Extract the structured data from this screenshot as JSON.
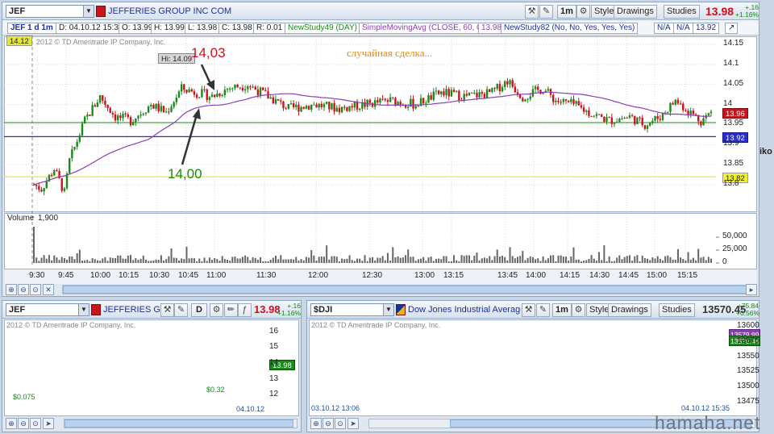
{
  "main": {
    "symbol": "JEF",
    "company": "JEFFERIES GROUP INC COM",
    "toolbar": {
      "interval": "1m",
      "style": "Style",
      "drawings": "Drawings",
      "studies": "Studies"
    },
    "last_price": "13.98",
    "change_abs": "+.16",
    "change_pct": "+1.16%",
    "info": {
      "period": "JEF 1 d 1m",
      "date": "D: 04.10.12 15:33",
      "open": "O: 13.99",
      "high": "H: 13.99",
      "low": "L: 13.98",
      "close": "C: 13.98",
      "range": "R: 0.01",
      "study1": "NewStudy49 (DAY)",
      "study2": "SimpleMovingAvg (CLOSE, 60, 0)",
      "study2_val": "13.98",
      "study3": "NewStudy82 (No, No, Yes, Yes, Yes)",
      "na1": "N/A",
      "na2": "N/A",
      "study3_val": "13.92"
    },
    "open_tag": "14.12",
    "watermark": "2012 © TD Ameritrade IP Company, Inc.",
    "hi_label": "Hi: 14.09",
    "annotation_high": "14,03",
    "annotation_low": "14,00",
    "annotation_text": "случайная сделка...",
    "y_ticks": [
      "14.15",
      "14.1",
      "14.05",
      "14",
      "13.95",
      "13.9",
      "13.85",
      "13.8"
    ],
    "price_tags": {
      "last": "13.96",
      "blue": "13.92",
      "yellow": "13.82"
    },
    "volume_label": "Volume",
    "volume_value": "1,900",
    "vol_ticks": [
      "50,000",
      "25,000",
      "0"
    ],
    "x_ticks": [
      "9:30",
      "9:45",
      "10:00",
      "10:15",
      "10:30",
      "10:45",
      "11:00",
      "11:30",
      "12:00",
      "12:30",
      "13:00",
      "13:15",
      "13:45",
      "14:00",
      "14:15",
      "14:30",
      "14:45",
      "15:00",
      "15:15"
    ],
    "side_text": "iko"
  },
  "bottom_left": {
    "symbol": "JEF",
    "company": "JEFFERIES GR...",
    "interval": "D",
    "last_price": "13.98",
    "change_abs": "+.16",
    "change_pct": "+1.16%",
    "watermark": "2012 © TD Ameritrade IP Company, Inc.",
    "y_ticks": [
      "16",
      "15",
      "14",
      "13",
      "12"
    ],
    "price_tag": "13.98",
    "low_label": "$0.075",
    "mid_label": "$0.32",
    "date_label": "04.10.12"
  },
  "bottom_right": {
    "symbol": "$DJI",
    "company": "Dow Jones Industrial Average",
    "toolbar": {
      "interval": "1m",
      "style": "Style",
      "drawings": "Drawings",
      "studies": "Studies"
    },
    "last_price": "13570.45",
    "change_abs": "+75.84",
    "change_pct": "+0.56%",
    "watermark": "2012 © TD Ameritrade IP Company, Inc.",
    "y_ticks": [
      "13600",
      "13575",
      "13550",
      "13525",
      "13500",
      "13475"
    ],
    "price_tag_top": "13579.99",
    "price_tag": "13570.44",
    "date_left": "03.10.12 13:06",
    "date_right": "04.10.12 15:35"
  },
  "site_watermark": "hamaha.net",
  "colors": {
    "bull": "#1a8a1a",
    "bear": "#c8141b",
    "sma": "#8b3fb5",
    "accent_red": "#d0101b",
    "annotation_orange": "#e08a18"
  }
}
